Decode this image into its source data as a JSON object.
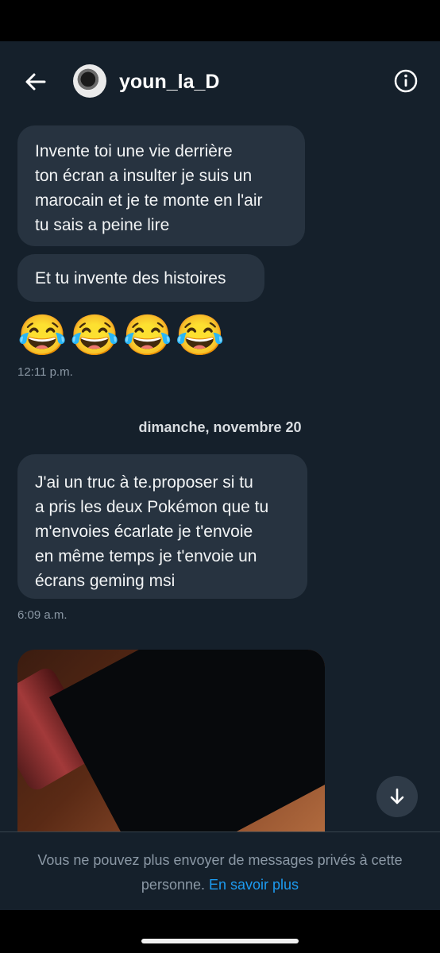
{
  "header": {
    "username": "youn_la_D",
    "back_icon": "arrow-left-icon",
    "info_icon": "info-circle-icon"
  },
  "messages": [
    {
      "text": "Invente toi une vie derrière\nton écran a insulter je suis un\nmarocain et je te monte en l'air\ntu sais a peine lire"
    },
    {
      "text": "Et tu invente des histoires"
    },
    {
      "text": "😂😂😂😂"
    },
    {
      "text": "J'ai un truc à te.proposer si tu\na pris les deux Pokémon que tu\nm'envoies écarlate je t'envoie\nen même temps je t'envoie un\nécrans geming msi"
    }
  ],
  "timestamps": [
    "12:11 p.m.",
    "6:09 a.m."
  ],
  "date_separator": "dimanche, novembre 20",
  "footer": {
    "notice": "Vous ne pouvez plus envoyer de messages privés à cette personne.",
    "link": "En savoir plus"
  },
  "colors": {
    "background": "#15202b",
    "bubble": "#273340",
    "link": "#1d9bf0",
    "muted": "#8b98a5"
  }
}
